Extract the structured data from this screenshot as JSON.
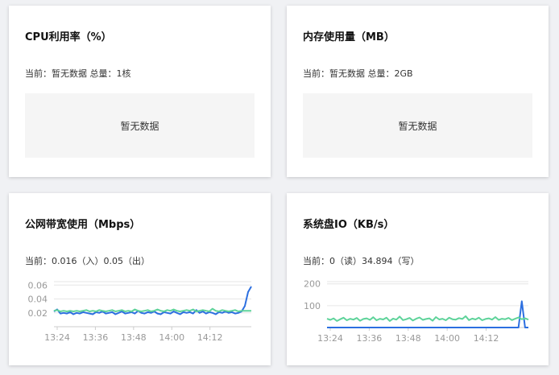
{
  "cards": {
    "cpu": {
      "title": "CPU利用率（%）",
      "current": "当前：暂无数据 总量：1核",
      "empty": "暂无数据"
    },
    "memory": {
      "title": "内存使用量（MB）",
      "current": "当前：暂无数据 总量：2GB",
      "empty": "暂无数据"
    },
    "network": {
      "title": "公网带宽使用（Mbps）",
      "current": "当前：0.016（入）0.05（出）"
    },
    "disk": {
      "title": "系统盘IO（KB/s）",
      "current": "当前：0（读）34.894（写）"
    }
  },
  "colors": {
    "inbound": "#2c6fe0",
    "outbound": "#5ed39a",
    "grid": "#e6e6e6",
    "axis_text": "#999999"
  },
  "chart_data": [
    {
      "type": "line",
      "title": "公网带宽使用（Mbps）",
      "y_ticks": [
        0.02,
        0.04,
        0.06
      ],
      "ylim": [
        0.0,
        0.065
      ],
      "x_ticks": [
        "13:24",
        "13:36",
        "13:48",
        "14:00",
        "14:12"
      ],
      "xlim_minutes": [
        0,
        62
      ],
      "series": [
        {
          "color_key": "inbound",
          "values": [
            0.022,
            0.025,
            0.019,
            0.02,
            0.019,
            0.021,
            0.018,
            0.02,
            0.019,
            0.021,
            0.02,
            0.019,
            0.018,
            0.021,
            0.02,
            0.022,
            0.019,
            0.02,
            0.021,
            0.018,
            0.02,
            0.022,
            0.019,
            0.02,
            0.021,
            0.019,
            0.023,
            0.02,
            0.019,
            0.021,
            0.02,
            0.022,
            0.019,
            0.018,
            0.021,
            0.02,
            0.019,
            0.022,
            0.02,
            0.018,
            0.021,
            0.02,
            0.021,
            0.019,
            0.024,
            0.02,
            0.022,
            0.019,
            0.021,
            0.02,
            0.018,
            0.021,
            0.02,
            0.022,
            0.02,
            0.021,
            0.019,
            0.02,
            0.022,
            0.03,
            0.05,
            0.058
          ]
        },
        {
          "color_key": "outbound",
          "values": [
            0.023,
            0.024,
            0.022,
            0.023,
            0.022,
            0.023,
            0.022,
            0.023,
            0.022,
            0.023,
            0.024,
            0.022,
            0.023,
            0.022,
            0.024,
            0.023,
            0.022,
            0.023,
            0.024,
            0.022,
            0.023,
            0.024,
            0.022,
            0.023,
            0.022,
            0.025,
            0.023,
            0.022,
            0.023,
            0.024,
            0.022,
            0.023,
            0.025,
            0.023,
            0.022,
            0.024,
            0.023,
            0.025,
            0.023,
            0.022,
            0.023,
            0.024,
            0.023,
            0.025,
            0.022,
            0.023,
            0.024,
            0.023,
            0.022,
            0.026,
            0.023,
            0.022,
            0.024,
            0.023,
            0.022,
            0.023,
            0.024,
            0.022,
            0.023,
            0.023,
            0.023,
            0.023
          ]
        }
      ]
    },
    {
      "type": "line",
      "title": "系统盘IO（KB/s）",
      "y_ticks": [
        100,
        200
      ],
      "ylim": [
        0,
        210
      ],
      "x_ticks": [
        "13:24",
        "13:36",
        "13:48",
        "14:00",
        "14:12"
      ],
      "xlim_minutes": [
        0,
        62
      ],
      "series": [
        {
          "color_key": "inbound",
          "values": [
            0,
            0,
            0,
            0,
            0,
            0,
            0,
            0,
            0,
            0,
            0,
            0,
            0,
            0,
            0,
            0,
            0,
            0,
            0,
            0,
            0,
            0,
            0,
            0,
            0,
            0,
            0,
            0,
            0,
            0,
            0,
            0,
            0,
            0,
            0,
            0,
            0,
            0,
            0,
            0,
            0,
            0,
            0,
            0,
            0,
            0,
            0,
            0,
            0,
            0,
            0,
            0,
            0,
            0,
            0,
            0,
            0,
            0,
            0,
            120,
            0,
            0
          ]
        },
        {
          "color_key": "outbound",
          "values": [
            40,
            35,
            42,
            30,
            38,
            45,
            33,
            40,
            36,
            44,
            31,
            39,
            42,
            35,
            47,
            33,
            40,
            37,
            45,
            30,
            41,
            36,
            50,
            34,
            38,
            44,
            32,
            40,
            46,
            35,
            39,
            42,
            31,
            48,
            37,
            40,
            33,
            45,
            38,
            36,
            43,
            39,
            52,
            34,
            41,
            37,
            45,
            33,
            39,
            42,
            36,
            48,
            35,
            40,
            38,
            44,
            34,
            40,
            46,
            38,
            42,
            36
          ]
        }
      ]
    }
  ]
}
